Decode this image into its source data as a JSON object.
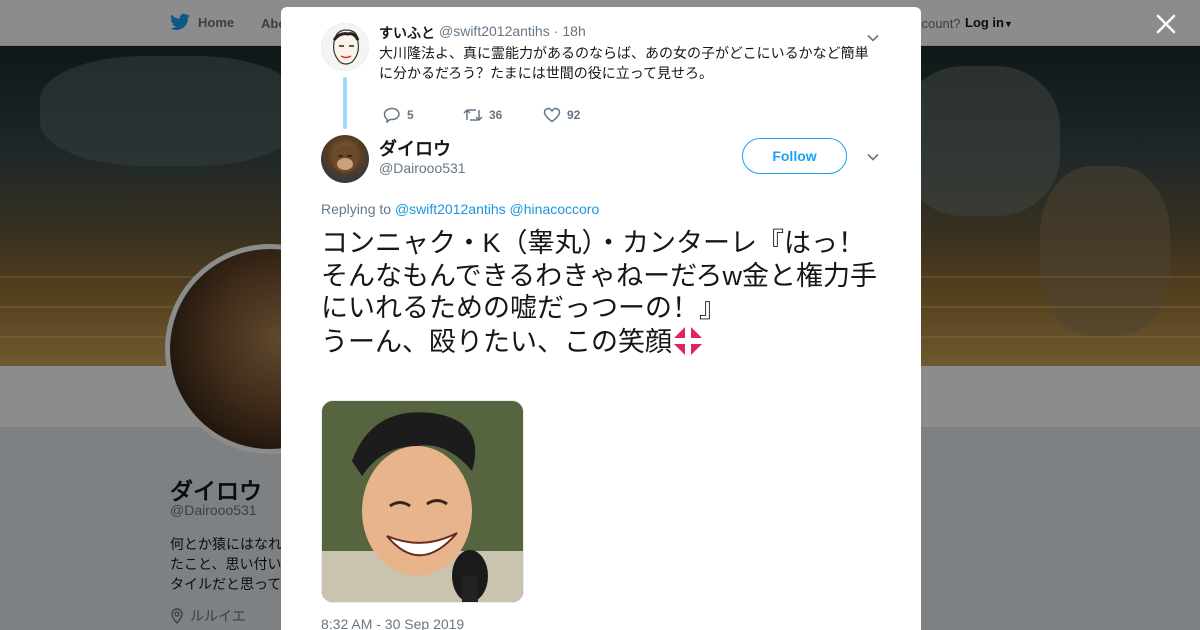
{
  "topbar": {
    "home_label": "Home",
    "about_label": "Abo",
    "account_prompt": "ccount?",
    "login_label": "Log in"
  },
  "profile": {
    "name": "ダイロウ",
    "handle": "@Dairooo531",
    "bio": "何とか猿にはなれ\nたこと、思い付い\nタイルだと思って",
    "location": "ルルイエ"
  },
  "parent_tweet": {
    "name": "すいふと",
    "handle": "@swift2012antihs",
    "separator": "·",
    "time": "18h",
    "text": "大川隆法よ、真に霊能力があるのならば、あの女の子がどこにいるかなど簡単に分かるだろう？たまには世間の役に立って見せろ。",
    "replies": "5",
    "retweets": "36",
    "likes": "92"
  },
  "main_tweet": {
    "name": "ダイロウ",
    "handle": "@Dairooo531",
    "follow_label": "Follow",
    "replying_prefix": "Replying to",
    "reply_to_1": "@swift2012antihs",
    "reply_to_2": "@hinacoccoro",
    "text": "コンニャク・K（睾丸）・カンターレ『はっ！\nそんなもんできるわきゃねーだろw金と権力手にいれるための嘘だっつーの！』\nうーん、殴りたい、この笑顔",
    "emoji_icon": "anger-symbol-icon",
    "timestamp": "8:32 AM - 30 Sep 2019"
  },
  "colors": {
    "accent": "#1da1f2",
    "link": "#1b95e0",
    "thread_line": "#a0d8f8",
    "muted": "#657786",
    "anger": "#e0245e"
  }
}
